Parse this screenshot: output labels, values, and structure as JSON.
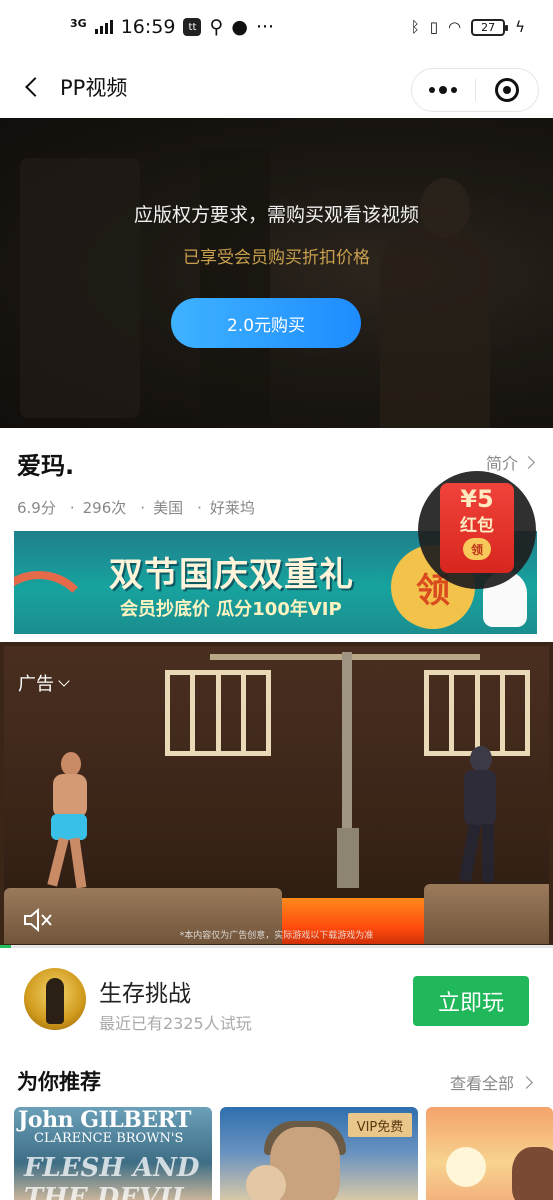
{
  "status_bar": {
    "network": "3G",
    "time": "16:59",
    "app_icon": "tt-icon",
    "battery": "27"
  },
  "nav": {
    "title": "PP视频"
  },
  "paywall": {
    "message": "应版权方要求，需购买观看该视频",
    "member_note": "已享受会员购买折扣价格",
    "buy_label": "2.0元购买",
    "colors": {
      "member_note": "#c9a04e",
      "button": "#1e8cff"
    }
  },
  "video": {
    "title": "爱玛.",
    "intro_label": "简介",
    "rating": "6.9分",
    "plays": "296次",
    "country": "美国",
    "studio": "好莱坞"
  },
  "promo_banner": {
    "title": "双节国庆双重礼",
    "subtitle": "会员抄底价  瓜分100年VIP",
    "badge": "领"
  },
  "red_packet": {
    "amount": "¥5",
    "label": "红包",
    "action": "领"
  },
  "ad": {
    "label": "广告",
    "disclaimer": "*本内容仅为广告创意，实际游戏以下载游戏为准",
    "progress": 0.02
  },
  "game": {
    "name": "生存挑战",
    "stat": "最近已有2325人试玩",
    "play_label": "立即玩"
  },
  "recommend": {
    "title": "为你推荐",
    "see_all": "查看全部",
    "posters": [
      {
        "title": "John GILBERT",
        "subtitle": "CLARENCE BROWN'S",
        "art_text": "FLESH AND THE DEVIL"
      },
      {
        "badge": "VIP免费"
      },
      {}
    ]
  }
}
